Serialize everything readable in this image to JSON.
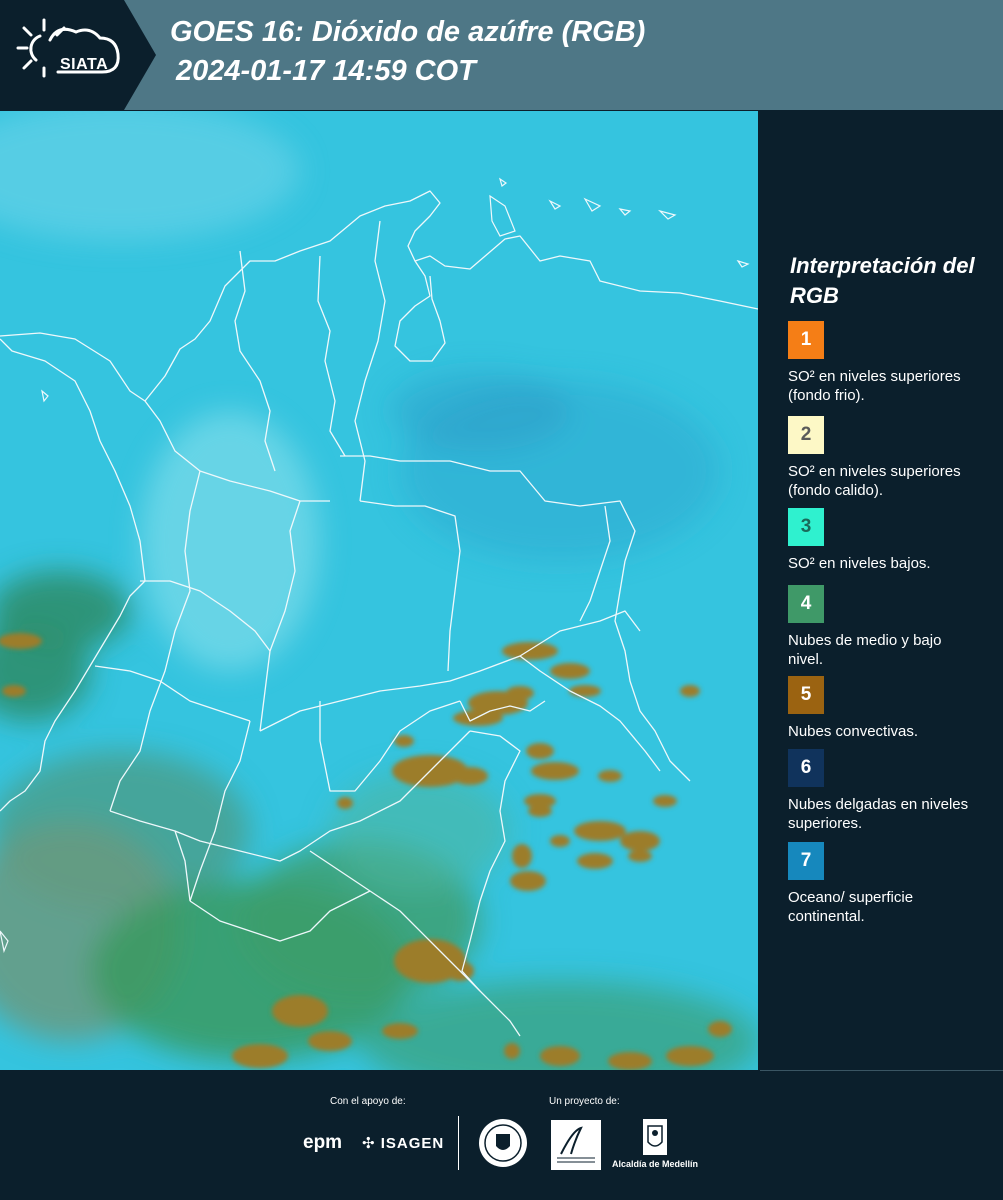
{
  "header": {
    "logo_text": "SIATA",
    "title_line1": "GOES 16: Dióxido de azúfre (RGB)",
    "title_line2": "2024-01-17 14:59 COT"
  },
  "legend": {
    "title": "Interpretación del RGB",
    "items": [
      {
        "number": "1",
        "color": "#f57e16",
        "text_color": "#ffffff",
        "label": "SO² en niveles superiores (fondo frio)."
      },
      {
        "number": "2",
        "color": "#fdf8c6",
        "text_color": "#5a5a5a",
        "label": "SO² en niveles superiores (fondo calido)."
      },
      {
        "number": "3",
        "color": "#2ff1cf",
        "text_color": "#1a6a5a",
        "label": "SO² en niveles bajos."
      },
      {
        "number": "4",
        "color": "#3f9968",
        "text_color": "#ffffff",
        "label": "Nubes de medio y bajo nivel."
      },
      {
        "number": "5",
        "color": "#9b6311",
        "text_color": "#ffffff",
        "label": "Nubes convectivas."
      },
      {
        "number": "6",
        "color": "#10335c",
        "text_color": "#ffffff",
        "label": "Nubes delgadas en niveles superiores."
      },
      {
        "number": "7",
        "color": "#1688bd",
        "text_color": "#ffffff",
        "label": "Oceano/ superficie continental."
      }
    ]
  },
  "footer": {
    "support_label": "Con el apoyo de:",
    "project_label": "Un proyecto de:",
    "epm": "epm",
    "isagen": "ISAGEN",
    "alcaldia": "Alcaldía de Medellín"
  },
  "colors": {
    "background": "#0b1f2c",
    "header_band": "#4e7786",
    "map_cyan": "#33c6e0",
    "map_green": "#3a8f6a",
    "map_convective": "#9b7a2a"
  }
}
